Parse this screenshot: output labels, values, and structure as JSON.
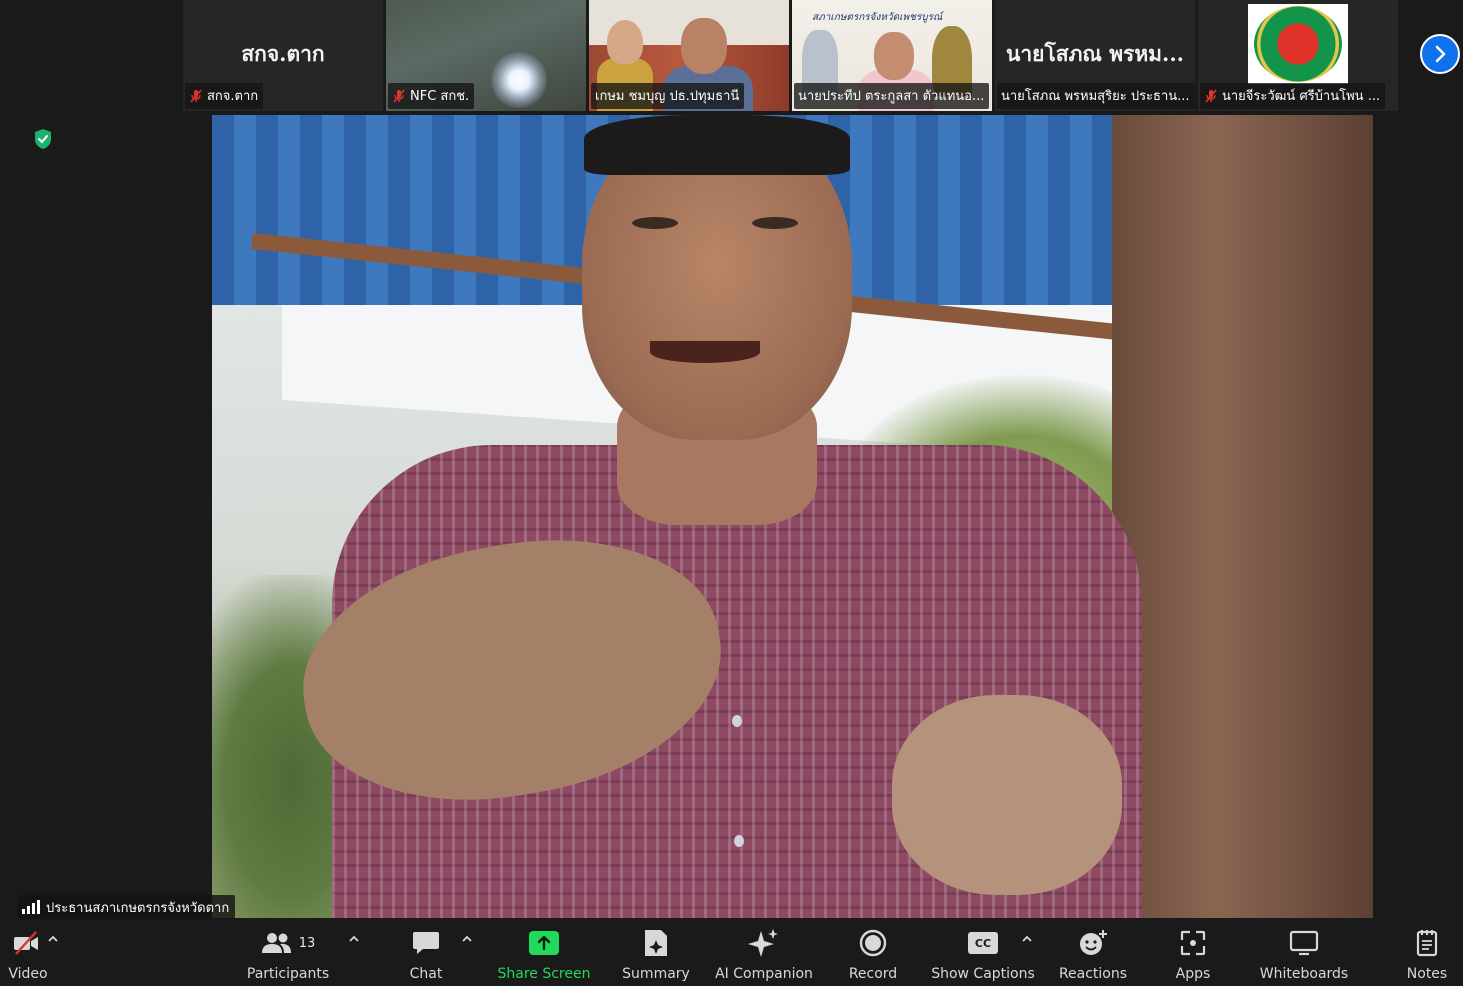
{
  "thumbnails": [
    {
      "big_name": "สกจ.ตาก",
      "caption": "สกจ.ตาก",
      "muted": true
    },
    {
      "big_name": "",
      "caption": "NFC สกช.",
      "muted": true
    },
    {
      "big_name": "",
      "caption": "เกษม ชมบุญ ปธ.ปทุมธานี",
      "muted": false
    },
    {
      "big_name": "",
      "caption": "นายประทีป ตระกูลสา ตัวแทนอ...",
      "muted": false,
      "banner": "สภาเกษตรกรจังหวัดเพชรบูรณ์"
    },
    {
      "big_name": "นายโสภณ พรหม...",
      "caption": "นายโสภณ พรหมสุริยะ ประธาน...",
      "muted": false
    },
    {
      "big_name": "",
      "caption": "นายจีระวัฒน์ ศรีบ้านโพน ...",
      "muted": true
    }
  ],
  "main_video": {
    "speaker_name": "ประธานสภาเกษตรกรจังหวัดตาก"
  },
  "toolbar": {
    "video_label": "Video",
    "participants_label": "Participants",
    "participants_count": "13",
    "chat_label": "Chat",
    "share_label": "Share Screen",
    "summary_label": "Summary",
    "ai_label": "AI Companion",
    "record_label": "Record",
    "captions_label": "Show Captions",
    "captions_icon_text": "CC",
    "reactions_label": "Reactions",
    "apps_label": "Apps",
    "whiteboards_label": "Whiteboards",
    "notes_label": "Notes"
  },
  "colors": {
    "background": "#1a1a1a",
    "share_green": "#23d959",
    "accent_blue": "#0e72ed",
    "mute_red": "#e0342b",
    "shield_green": "#1bb36b"
  }
}
